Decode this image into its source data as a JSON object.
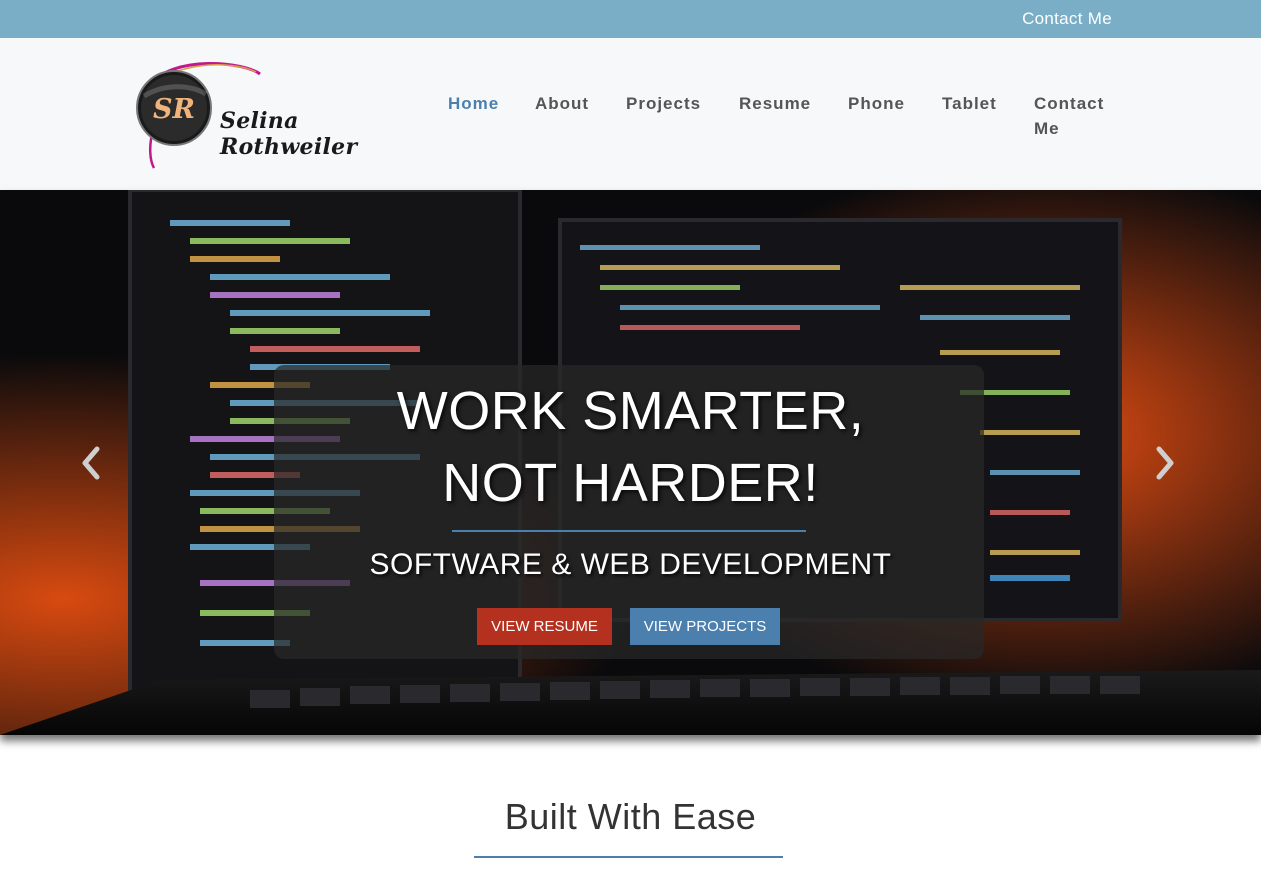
{
  "topbar": {
    "contact_link": "Contact Me"
  },
  "brand": {
    "monogram": "SR",
    "name": "Selina Rothweiler"
  },
  "nav": {
    "home": "Home",
    "about": "About",
    "projects": "Projects",
    "resume": "Resume",
    "phone": "Phone",
    "tablet": "Tablet",
    "contact_line1": "Contact",
    "contact_line2": "Me"
  },
  "hero": {
    "headline_line1": "WORK SMARTER,",
    "headline_line2": "NOT HARDER!",
    "subheadline": "SOFTWARE & WEB DEVELOPMENT",
    "resume_button": "VIEW RESUME",
    "projects_button": "VIEW PROJECTS",
    "prev_icon": "chevron-left-icon",
    "next_icon": "chevron-right-icon"
  },
  "section": {
    "title": "Built With Ease"
  },
  "colors": {
    "topbar": "#79aec6",
    "accent_blue": "#4a7fae",
    "accent_red": "#b4311f",
    "header_bg": "#f6f8f9"
  }
}
